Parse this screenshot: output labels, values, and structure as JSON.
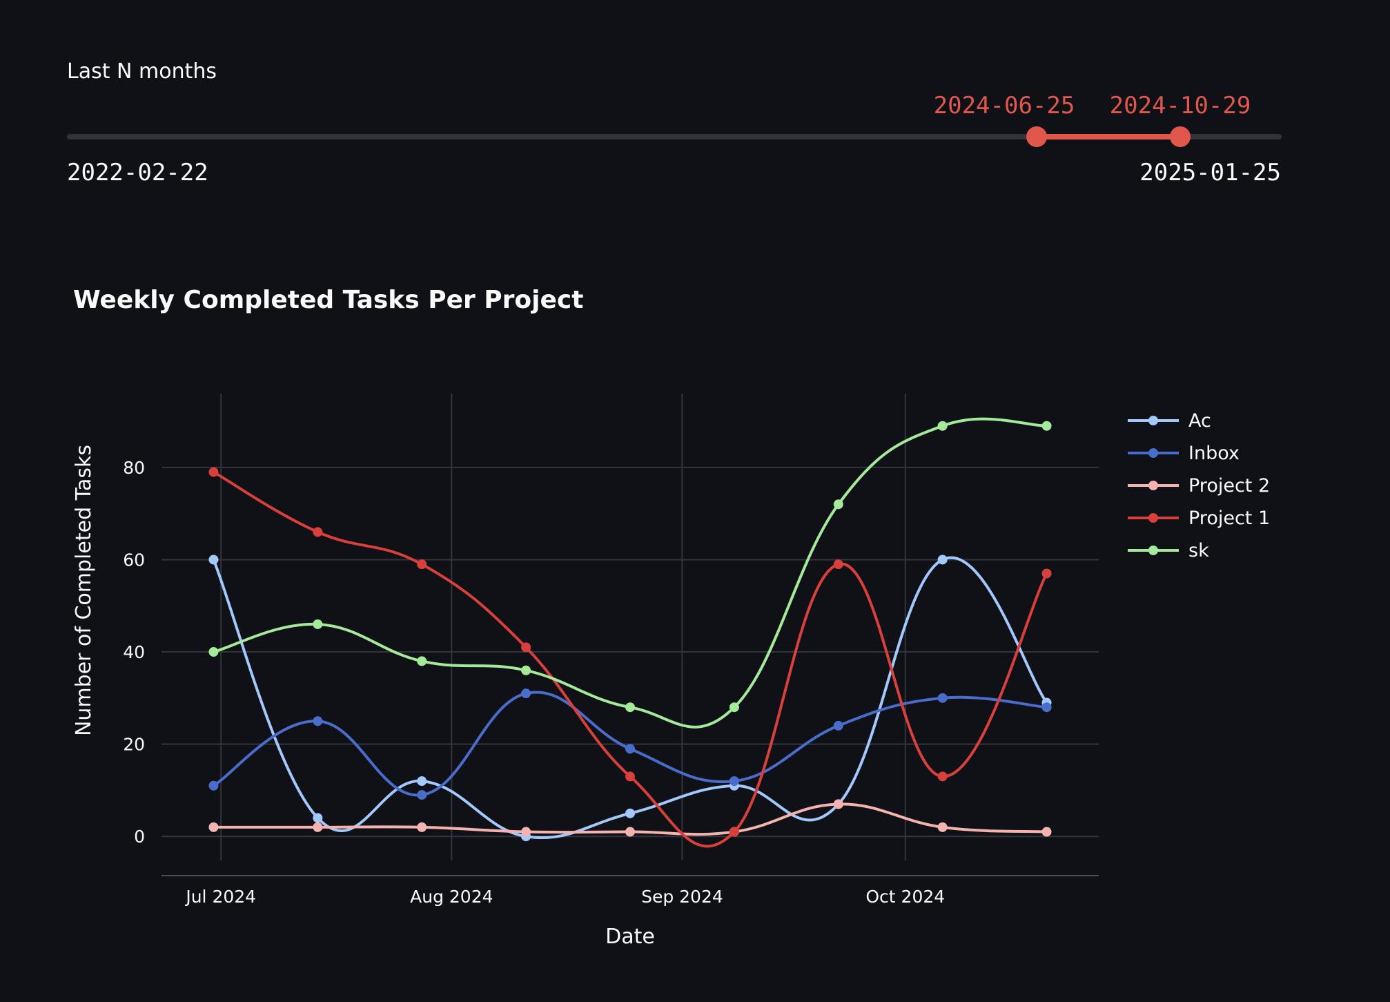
{
  "slider": {
    "label": "Last N months",
    "min_label": "2022-02-22",
    "max_label": "2025-01-25",
    "low_value": "2024-06-25",
    "high_value": "2024-10-29",
    "accent_color": "#e1574c"
  },
  "chart_data": {
    "type": "line",
    "title": "Weekly Completed Tasks Per Project",
    "xlabel": "Date",
    "ylabel": "Number of Completed Tasks",
    "x": [
      "2024-06-30",
      "2024-07-14",
      "2024-07-28",
      "2024-08-11",
      "2024-08-25",
      "2024-09-08",
      "2024-09-22",
      "2024-10-06",
      "2024-10-20"
    ],
    "x_ticks": [
      {
        "date": "2024-07-01",
        "label": "Jul 2024"
      },
      {
        "date": "2024-08-01",
        "label": "Aug 2024"
      },
      {
        "date": "2024-09-01",
        "label": "Sep 2024"
      },
      {
        "date": "2024-10-01",
        "label": "Oct 2024"
      }
    ],
    "xlim": [
      "2024-06-23",
      "2024-10-27"
    ],
    "y_ticks": [
      0,
      20,
      40,
      60,
      80
    ],
    "ylim": [
      -8.5,
      96
    ],
    "grid": true,
    "legend_position": "right",
    "series": [
      {
        "name": "Ac",
        "color": "#a3c8fb",
        "values": [
          60,
          4,
          12,
          0,
          5,
          11,
          7,
          60,
          29
        ]
      },
      {
        "name": "Inbox",
        "color": "#4a6dcc",
        "values": [
          11,
          25,
          9,
          31,
          19,
          12,
          24,
          30,
          28
        ]
      },
      {
        "name": "Project 2",
        "color": "#f5b3b0",
        "values": [
          2,
          2,
          2,
          1,
          1,
          1,
          7,
          2,
          1
        ]
      },
      {
        "name": "Project 1",
        "color": "#d93f3b",
        "values": [
          79,
          66,
          59,
          41,
          13,
          1,
          59,
          13,
          57
        ]
      },
      {
        "name": "sk",
        "color": "#a5ea9a",
        "values": [
          40,
          46,
          38,
          36,
          28,
          28,
          72,
          89,
          89
        ]
      }
    ]
  }
}
